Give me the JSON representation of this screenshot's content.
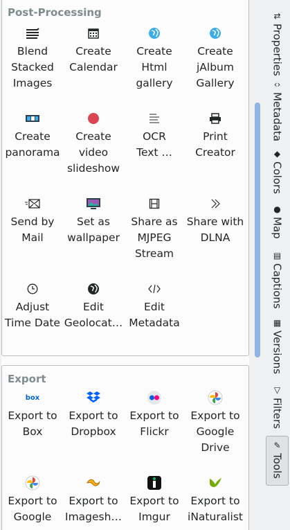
{
  "post_processing": {
    "title": "Post-Processing",
    "tools": [
      {
        "label": "Blend\nStacked\nImages",
        "icon": "blend-stack-icon"
      },
      {
        "label": "Create\nCalendar",
        "icon": "calendar-icon"
      },
      {
        "label": "Create\nHtml\ngallery",
        "icon": "globe-icon"
      },
      {
        "label": "Create\njAlbum\nGallery",
        "icon": "globe-icon"
      },
      {
        "label": "Create\npanorama",
        "icon": "panorama-icon"
      },
      {
        "label": "Create\nvideo\nslideshow",
        "icon": "video-slideshow-icon"
      },
      {
        "label": "OCR\nText …",
        "icon": "text-lines-icon"
      },
      {
        "label": "Print\nCreator",
        "icon": "printer-icon"
      },
      {
        "label": "Send by\nMail",
        "icon": "mail-icon"
      },
      {
        "label": "Set as\nwallpaper",
        "icon": "monitor-icon"
      },
      {
        "label": "Share as\nMJPEG\nStream",
        "icon": "film-icon"
      },
      {
        "label": "Share with\nDLNA",
        "icon": "double-chevron-icon"
      },
      {
        "label": "Adjust\nTime  Date",
        "icon": "clock-icon"
      },
      {
        "label": "Edit\nGeolocat…",
        "icon": "globe-dark-icon"
      },
      {
        "label": "Edit\nMetadata",
        "icon": "code-icon"
      }
    ]
  },
  "export": {
    "title": "Export",
    "tools": [
      {
        "label": "Export to\nBox",
        "icon": "box-logo-icon"
      },
      {
        "label": "Export to\nDropbox",
        "icon": "dropbox-logo-icon"
      },
      {
        "label": "Export to\nFlickr",
        "icon": "flickr-logo-icon"
      },
      {
        "label": "Export to\nGoogle\nDrive",
        "icon": "google-photos-icon"
      },
      {
        "label": "Export to\nGoogle",
        "icon": "google-photos-icon"
      },
      {
        "label": "Export to\nImagesh…",
        "icon": "imageshack-logo-icon"
      },
      {
        "label": "Export to\nImgur",
        "icon": "imgur-logo-icon"
      },
      {
        "label": "Export to\niNaturalist",
        "icon": "inaturalist-logo-icon"
      }
    ]
  },
  "sidebar_tabs": [
    {
      "label": "Properties",
      "icon": "properties-icon"
    },
    {
      "label": "Metadata",
      "icon": "code-icon"
    },
    {
      "label": "Colors",
      "icon": "paint-bucket-icon"
    },
    {
      "label": "Map",
      "icon": "globe-icon"
    },
    {
      "label": "Captions",
      "icon": "caption-icon"
    },
    {
      "label": "Versions",
      "icon": "versions-icon"
    },
    {
      "label": "Filters",
      "icon": "filter-icon"
    },
    {
      "label": "Tools",
      "icon": "pencil-icon",
      "active": true
    }
  ],
  "colors": {
    "accent": "#3daee9",
    "scroll_thumb": "#8fb5e2",
    "section_title": "#7f8c8d"
  }
}
